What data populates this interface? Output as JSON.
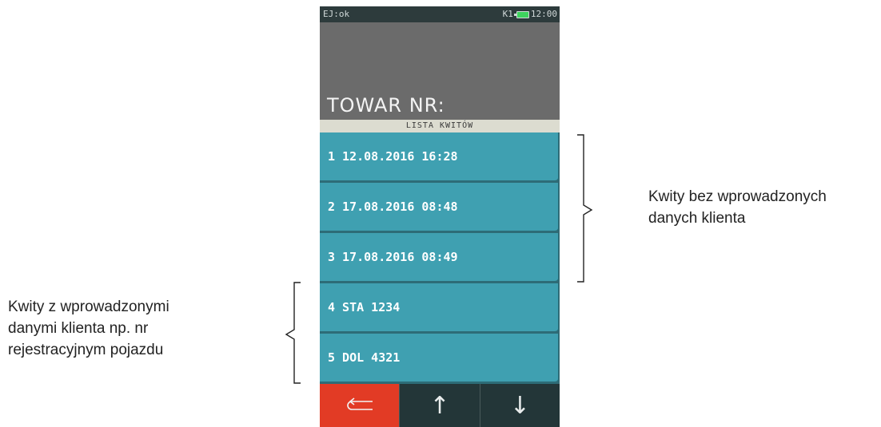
{
  "status_bar": {
    "left": "EJ:ok",
    "right_label": "K1",
    "time": "12:00"
  },
  "display": {
    "prompt": "TOWAR NR:"
  },
  "list_header": "LISTA KWITÓW",
  "receipts": [
    {
      "label": "1 12.08.2016 16:28"
    },
    {
      "label": "2 17.08.2016 08:48"
    },
    {
      "label": "3 17.08.2016 08:49"
    },
    {
      "label": "4 STA 1234"
    },
    {
      "label": "5 DOL 4321"
    }
  ],
  "toolbar": {
    "back_icon": "back-arrow-icon",
    "up_icon": "arrow-up-icon",
    "down_icon": "arrow-down-icon",
    "back_glyph": "⮌",
    "up_glyph": "↑",
    "down_glyph": "↓"
  },
  "annotations": {
    "right_line1": "Kwity bez wprowadzonych",
    "right_line2": "danych klienta",
    "left_line1": "Kwity z wprowadzonymi",
    "left_line2": "danymi klienta np. nr",
    "left_line3": "rejestracyjnym pojazdu"
  },
  "colors": {
    "back_button": "#e23b25",
    "list_item": "#3fa0b1",
    "display": "#6b6b6b"
  }
}
